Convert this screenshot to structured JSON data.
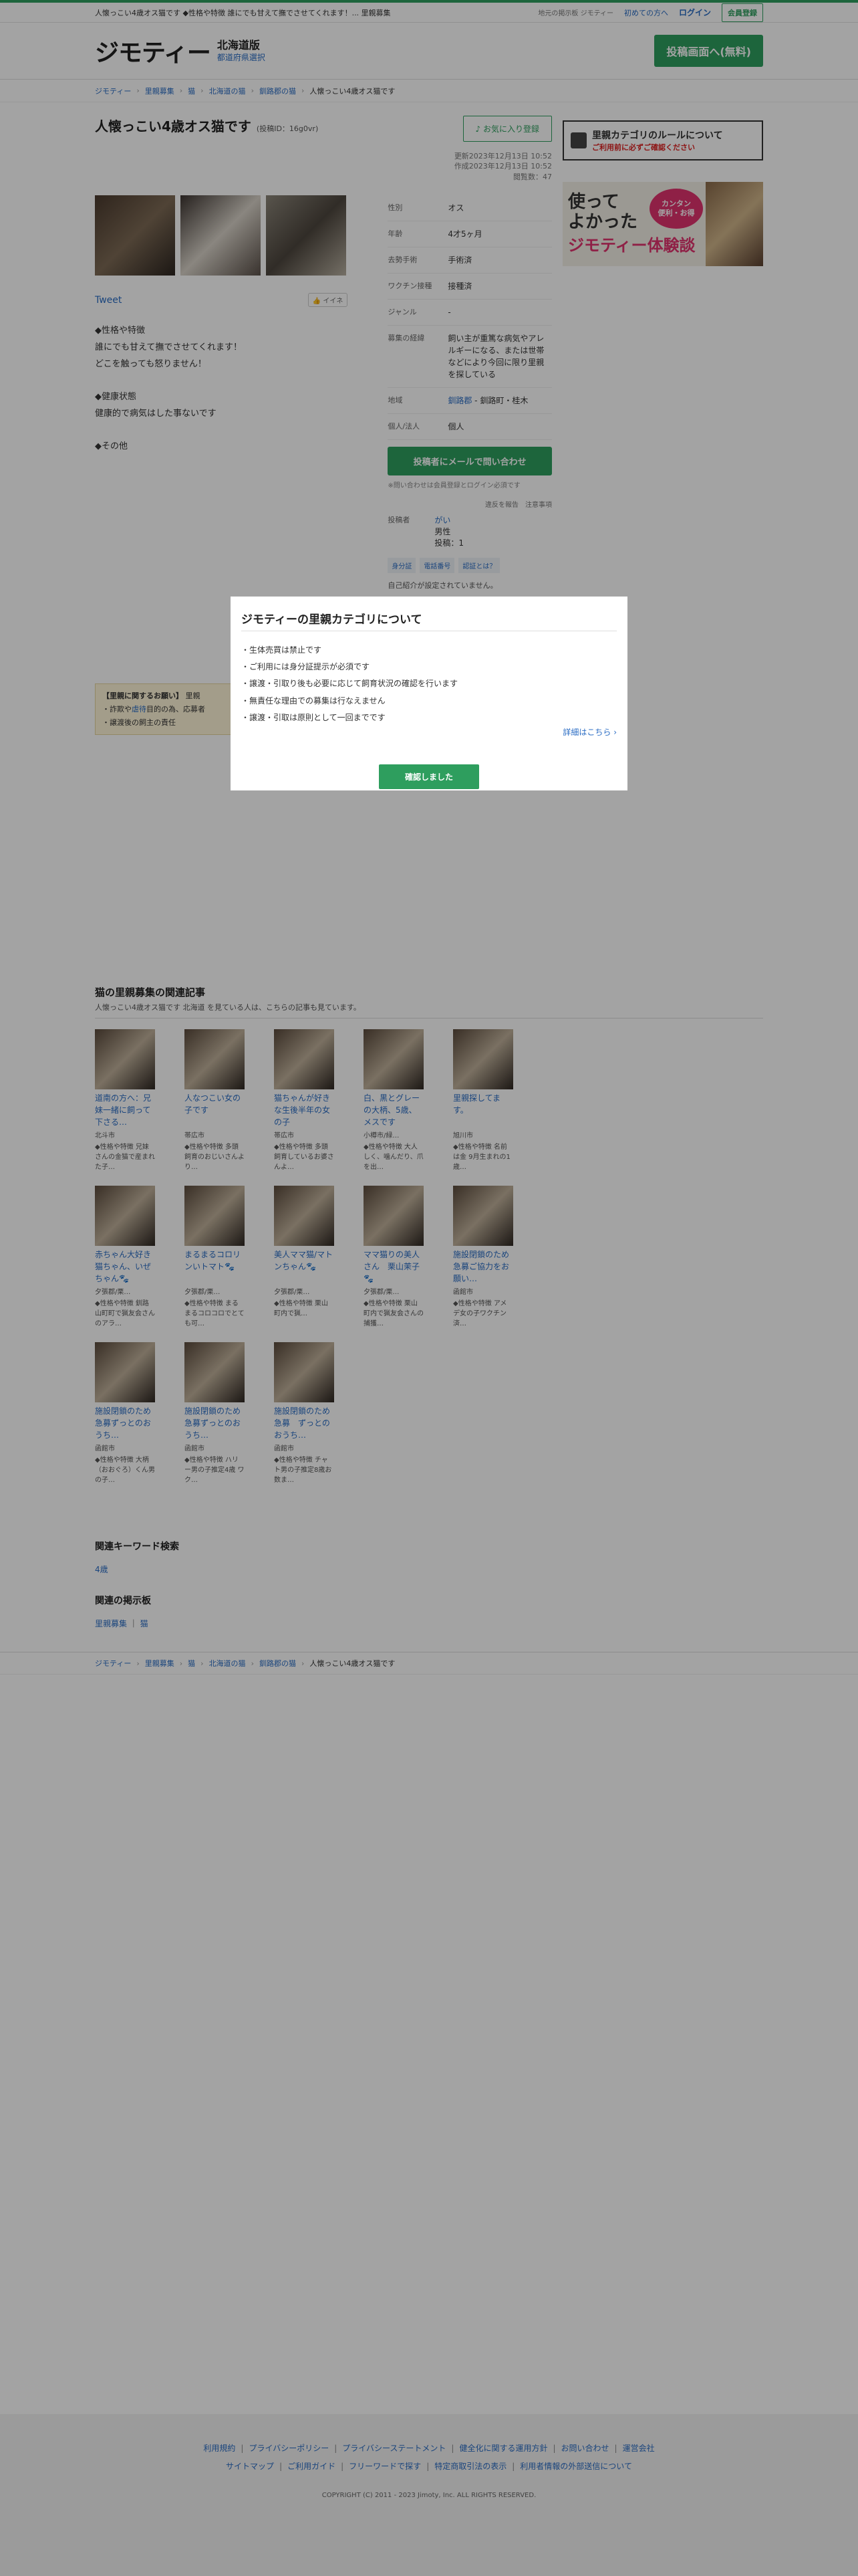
{
  "topbar": {
    "description": "人懐っこい4歳オス猫です ◆性格や特徴 誰にでも甘えて撫でさせてくれます！... 里親募集",
    "nav_label": "地元の掲示板 ジモティー",
    "first_time": "初めての方へ",
    "login": "ログイン",
    "register": "会員登録"
  },
  "header": {
    "logo": "ジモティー",
    "prefecture": "北海道版",
    "region_select": "都道府県選択",
    "post_button": "投稿画面へ(無料)"
  },
  "breadcrumbs": [
    "ジモティー",
    "里親募集",
    "猫",
    "北海道の猫",
    "釧路郡の猫",
    "人懐っこい4歳オス猫です"
  ],
  "listing": {
    "title": "人懐っこい4歳オス猫です",
    "post_id": "(投稿ID：16g0vr)",
    "fav_button": "♪ お気に入り登録",
    "updated": "更新2023年12月13日 10:52",
    "created": "作成2023年12月13日 10:52",
    "views": "閲覧数：47",
    "tweet": "Tweet",
    "iine": "イイネ",
    "description": "◆性格や特徴\n誰にでも甘えて撫でさせてくれます！\nどこを触っても怒りません！\n\n◆健康状態\n健康的で病気はした事ないです\n\n◆その他",
    "specs": [
      {
        "k": "性別",
        "v": "オス"
      },
      {
        "k": "年齢",
        "v": "4才5ヶ月"
      },
      {
        "k": "去勢手術",
        "v": "手術済"
      },
      {
        "k": "ワクチン接種",
        "v": "接種済"
      },
      {
        "k": "ジャンル",
        "v": "-"
      },
      {
        "k": "募集の経緯",
        "v": "飼い主が重篤な病気やアレルギーになる、または世帯などにより今回に限り里親を探している"
      }
    ],
    "area_label": "地域",
    "area_link": "釧路郡",
    "area_rest": "- 釧路町・桂木",
    "party_label": "個人/法人",
    "party_value": "個人",
    "contact_button": "投稿者にメールで問い合わせ",
    "contact_note": "※問い合わせは会員登録とログイン必須です",
    "report": "違反を報告　注意事項",
    "poster_label": "投稿者",
    "poster_name": "がい",
    "poster_gender": "男性",
    "poster_count": "投稿：1",
    "tags": [
      "身分証",
      "電話番号",
      "認証とは？"
    ],
    "no_condition": "自己紹介が設定されていません。"
  },
  "caution": {
    "title": "【里親に関するお願い】",
    "title_rest": "里親",
    "line1_prefix": "・詐欺や",
    "line1_link": "虐待",
    "line1_suffix": "目的の為、応募者",
    "line2": "・譲渡後の飼主の責任"
  },
  "side": {
    "rule_banner_title": "里親カテゴリのルールについて",
    "rule_banner_sub": "ご利用前に必ずご確認ください",
    "exp_banner_a": "使って",
    "exp_banner_b": "よかった",
    "exp_banner_c": "ジモティー",
    "exp_banner_d": "体験談",
    "exp_bubble": "カンタン\n便利・お得"
  },
  "related": {
    "title": "猫の里親募集の関連記事",
    "subtitle": "人懐っこい4歳オス猫です 北海道 を見ている人は、こちらの記事も見ています。",
    "items": [
      {
        "title": "道南の方へ：兄妹一緒に飼って下さる…",
        "loc": "北斗市",
        "desc": "◆性格や特徴 兄妹さんの金猫で産まれた子…"
      },
      {
        "title": "人なつこい女の子です",
        "loc": "帯広市",
        "desc": "◆性格や特徴 多頭飼育のおじいさんより…"
      },
      {
        "title": "猫ちゃんが好きな生後半年の女の子",
        "loc": "帯広市",
        "desc": "◆性格や特徴 多頭飼育しているお婆さんよ…"
      },
      {
        "title": "白、黒とグレーの大柄、5歳、メスです",
        "loc": "小樽市/緑…",
        "desc": "◆性格や特徴 大人しく、噛んだり、爪を出…"
      },
      {
        "title": "里親探してます。",
        "loc": "旭川市",
        "desc": "◆性格や特徴 名前は金 9月生まれの1歳…"
      },
      {
        "title": "赤ちゃん大好き猫ちゃん、いぜちゃん🐾",
        "loc": "夕張郡/栗…",
        "desc": "◆性格や特徴 釧路山町町で猟友会さんのアラ…"
      },
      {
        "title": "まるまるコロリンいトマト🐾",
        "loc": "夕張郡/栗…",
        "desc": "◆性格や特徴 まるまるコロコロでとても可…"
      },
      {
        "title": "美人ママ猫/マトンちゃん🐾",
        "loc": "夕張郡/栗…",
        "desc": "◆性格や特徴 栗山町内で猟…"
      },
      {
        "title": "ママ猫りの美人さん　栗山茉子🐾",
        "loc": "夕張郡/栗…",
        "desc": "◆性格や特徴 栗山町内で猟友会さんの捕獲…"
      },
      {
        "title": "施設閉鎖のため急募ご協力をお願い…",
        "loc": "函館市",
        "desc": "◆性格や特徴 アメデ女の子ワクチン済…"
      },
      {
        "title": "施設閉鎖のため急募ずっとのおうち…",
        "loc": "函館市",
        "desc": "◆性格や特徴 大柄（おおぐろ）くん男の子…"
      },
      {
        "title": "施設閉鎖のため急募ずっとのおうち…",
        "loc": "函館市",
        "desc": "◆性格や特徴 ハリー男の子推定4歳 ワク…"
      },
      {
        "title": "施設閉鎖のため急募　ずっとのおうち…",
        "loc": "函館市",
        "desc": "◆性格や特徴 チャト男の子推定8歳お数ま…"
      }
    ]
  },
  "keywords": {
    "title": "関連キーワード検索",
    "items": [
      "4歳"
    ],
    "board_title": "関連の掲示板",
    "boards": [
      "里親募集",
      "猫"
    ]
  },
  "footer": {
    "row1": [
      "利用規約",
      "プライバシーポリシー",
      "プライバシーステートメント",
      "健全化に関する運用方針",
      "お問い合わせ",
      "運営会社"
    ],
    "row2": [
      "サイトマップ",
      "ご利用ガイド",
      "フリーワードで探す",
      "特定商取引法の表示",
      "利用者情報の外部送信について"
    ],
    "copyright": "COPYRIGHT (C) 2011 - 2023 Jimoty, Inc. ALL RIGHTS RESERVED."
  },
  "modal": {
    "title": "ジモティーの里親カテゴリについて",
    "rules": [
      "・生体売買は禁止です",
      "・ご利用には身分証提示が必須です",
      "・譲渡・引取り後も必要に応じて飼育状況の確認を行います",
      "・無責任な理由での募集は行なえません",
      "・譲渡・引取は原則として一回までです"
    ],
    "more": "詳細はこちら ›",
    "ok": "確認しました"
  }
}
